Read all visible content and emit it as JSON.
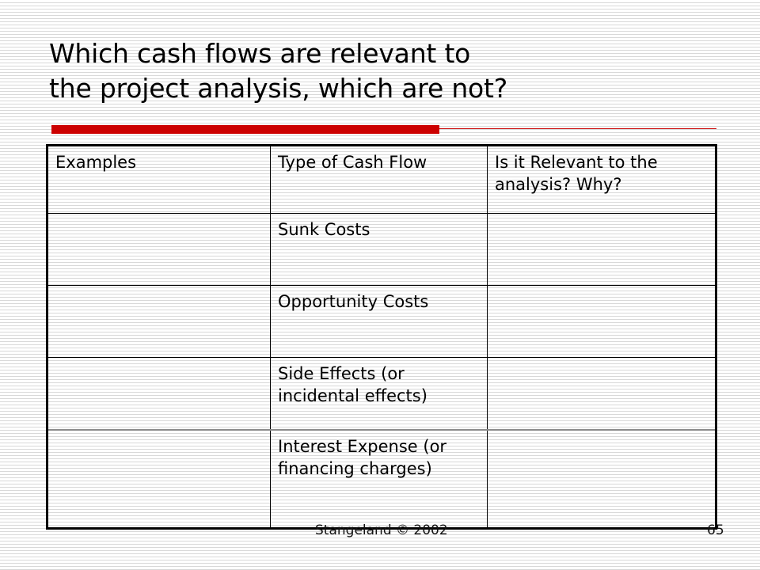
{
  "slide": {
    "title_line_1": "Which cash flows are relevant to",
    "title_line_2": "the project analysis, which are not?",
    "accent_color": "#cc0000",
    "text_color": "#000000"
  },
  "table": {
    "headers": [
      "Examples",
      "Type of Cash Flow",
      "Is it Relevant to the analysis? Why?"
    ],
    "rows": [
      {
        "examples": "",
        "type_of_cash_flow": "Sunk Costs",
        "relevant": ""
      },
      {
        "examples": "",
        "type_of_cash_flow": "Opportunity Costs",
        "relevant": ""
      },
      {
        "examples": "",
        "type_of_cash_flow": "Side Effects (or incidental effects)",
        "relevant": ""
      },
      {
        "examples": "",
        "type_of_cash_flow": "Interest Expense (or financing charges)",
        "relevant": ""
      }
    ]
  },
  "footer": {
    "credit": "Stangeland © 2002",
    "page_number": "65"
  }
}
